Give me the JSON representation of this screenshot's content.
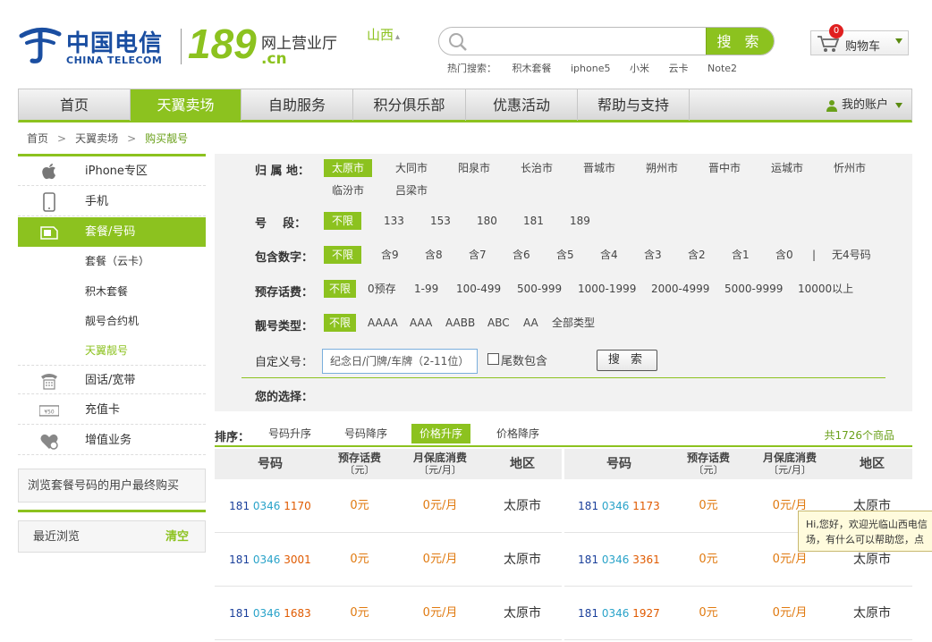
{
  "header": {
    "logo_cn": "中国电信",
    "logo_en": "CHINA TELECOM",
    "logo_189": "189",
    "logo_hall": "网上营业厅",
    "logo_cn_domain": ".cn",
    "region": "山西",
    "search_placeholder": "",
    "search_button": "搜 索",
    "hot_label": "热门搜索：",
    "hot_terms": [
      "积木套餐",
      "iphone5",
      "小米",
      "云卡",
      "Note2"
    ],
    "cart_count": "0",
    "cart_label": "购物车"
  },
  "nav": {
    "items": [
      "首页",
      "天翼卖场",
      "自助服务",
      "积分俱乐部",
      "优惠活动",
      "帮助与支持"
    ],
    "active_index": 1,
    "account": "我的账户"
  },
  "breadcrumb": [
    "首页",
    "天翼卖场",
    "购买靓号"
  ],
  "sidebar": {
    "items": [
      {
        "label": "iPhone专区",
        "icon": "apple-icon"
      },
      {
        "label": "手机",
        "icon": "phone-icon"
      },
      {
        "label": "套餐/号码",
        "icon": "sim-card-icon"
      },
      {
        "label": "固话/宽带",
        "icon": "landline-icon"
      },
      {
        "label": "充值卡",
        "icon": "recharge-card-icon"
      },
      {
        "label": "增值业务",
        "icon": "value-added-icon"
      }
    ],
    "sub_items": [
      "套餐（云卡）",
      "积木套餐",
      "靓号合约机",
      "天翼靓号"
    ],
    "active_sub": 3,
    "box1": "浏览套餐号码的用户最终购买",
    "box2": "最近浏览",
    "box2_action": "清空"
  },
  "filter": {
    "location_label": "归 属 地：",
    "locations": [
      "太原市",
      "大同市",
      "阳泉市",
      "长治市",
      "晋城市",
      "朔州市",
      "晋中市",
      "运城市",
      "忻州市",
      "临汾市",
      "吕梁市"
    ],
    "segment_label": "号    段：",
    "segments": [
      "不限",
      "133",
      "153",
      "180",
      "181",
      "189"
    ],
    "digits_label": "包含数字：",
    "digits": [
      "不限",
      "含9",
      "含8",
      "含7",
      "含6",
      "含5",
      "含4",
      "含3",
      "含2",
      "含1",
      "含0"
    ],
    "digits_sep": "|",
    "digits_extra": "无4号码",
    "prepaid_label": "预存话费：",
    "prepaid": [
      "不限",
      "0预存",
      "1-99",
      "100-499",
      "500-999",
      "1000-1999",
      "2000-4999",
      "5000-9999",
      "10000以上"
    ],
    "type_label": "靓号类型：",
    "types": [
      "不限",
      "AAAA",
      "AAA",
      "AABB",
      "ABC",
      "AA",
      "全部类型"
    ],
    "custom_label": "自定义号：",
    "custom_placeholder": "纪念日/门牌/车牌（2-11位）",
    "tail_label": "尾数包含",
    "search_button": "搜 索",
    "choice_label": "您的选择："
  },
  "sort": {
    "label": "排序：",
    "options": [
      "号码升序",
      "号码降序",
      "价格升序",
      "价格降序"
    ],
    "active_index": 2,
    "total": "共1726个商品"
  },
  "table": {
    "headers": {
      "number": "号码",
      "prepaid_l1": "预存话费",
      "prepaid_l2": "〔元〕",
      "monthly_l1": "月保底消费",
      "monthly_l2": "〔元/月〕",
      "region": "地区"
    },
    "rows": [
      {
        "left": {
          "p1": "181",
          "p2": "0346",
          "p3": "1170",
          "prepaid": "0元",
          "monthly": "0元/月",
          "region": "太原市"
        },
        "right": {
          "p1": "181",
          "p2": "0346",
          "p3": "1173",
          "prepaid": "0元",
          "monthly": "0元/月",
          "region": "太原市"
        }
      },
      {
        "left": {
          "p1": "181",
          "p2": "0346",
          "p3": "3001",
          "prepaid": "0元",
          "monthly": "0元/月",
          "region": "太原市"
        },
        "right": {
          "p1": "181",
          "p2": "0346",
          "p3": "3361",
          "prepaid": "0元",
          "monthly": "0元/月",
          "region": "太原市"
        }
      },
      {
        "left": {
          "p1": "181",
          "p2": "0346",
          "p3": "1683",
          "prepaid": "0元",
          "monthly": "0元/月",
          "region": "太原市"
        },
        "right": {
          "p1": "181",
          "p2": "0346",
          "p3": "1927",
          "prepaid": "0元",
          "monthly": "0元/月",
          "region": "太原市"
        }
      }
    ]
  },
  "tooltip": {
    "line1": "Hi,您好，欢迎光临山西电信",
    "line2": "场，有什么可以帮助您，点"
  },
  "colors": {
    "brand_green": "#8cc21f",
    "telecom_blue": "#1a4ea1"
  }
}
